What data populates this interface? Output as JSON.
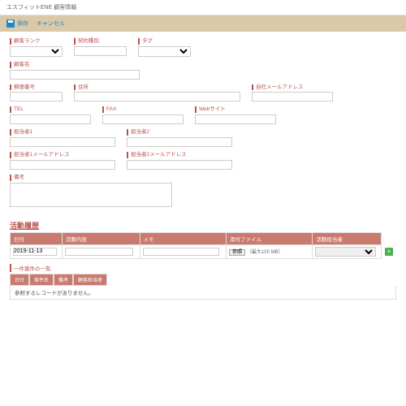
{
  "header": {
    "title": "エスフィットENE 顧客情報"
  },
  "actions": {
    "save": "保存",
    "cancel": "キャンセル"
  },
  "labels": {
    "rank": "顧客ランク",
    "contract_type": "契約種別",
    "tag": "タグ",
    "customer_name": "顧客名",
    "postal": "郵便番号",
    "address": "住所",
    "company_email": "自社メールアドレス",
    "tel": "TEL",
    "fax": "FAX",
    "website": "Webサイト",
    "contact1": "担当者1",
    "contact2": "担当者2",
    "contact1_email": "担当者1メールアドレス",
    "contact2_email": "担当者2メールアドレス",
    "notes": "備考"
  },
  "history": {
    "title": "活動履歴",
    "columns": {
      "date": "日付",
      "content": "活動内容",
      "memo": "メモ",
      "file": "添付ファイル",
      "person": "活動担当者"
    },
    "rows": [
      {
        "date": "2019-11-13"
      }
    ],
    "file_button": "参照",
    "file_note": "（最大100 MB）"
  },
  "matters": {
    "title": "一件案件の一覧",
    "columns": {
      "c1": "日付",
      "c2": "案件名",
      "c3": "備考",
      "c4": "顧客担当者"
    },
    "empty": "参照するレコードがありません。"
  }
}
